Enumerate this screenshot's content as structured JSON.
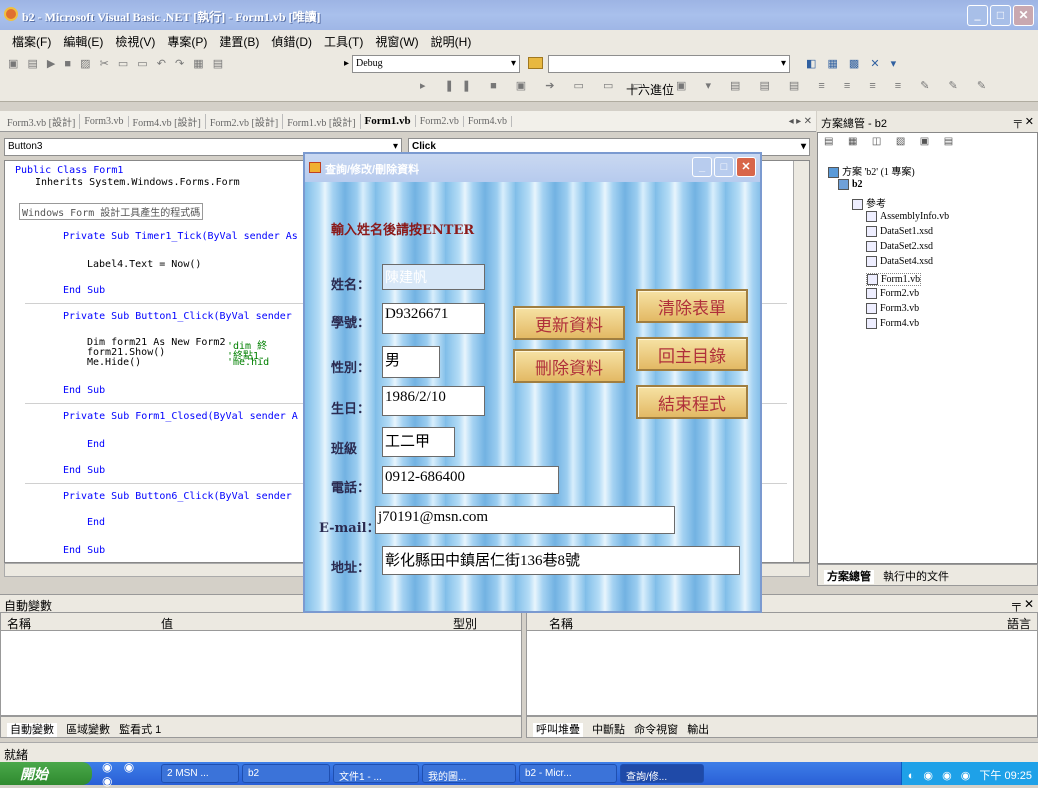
{
  "window": {
    "title": "b2 - Microsoft Visual Basic .NET [執行] - Form1.vb [唯讀]"
  },
  "menu": [
    "檔案(F)",
    "編輯(E)",
    "檢視(V)",
    "專案(P)",
    "建置(B)",
    "偵錯(D)",
    "工具(T)",
    "視窗(W)",
    "說明(H)"
  ],
  "toolbar": {
    "config": "Debug",
    "hex_label": "十六進位"
  },
  "tabs": [
    "Form3.vb [設計]",
    "Form3.vb",
    "Form4.vb [設計]",
    "Form2.vb [設計]",
    "Form1.vb [設計]",
    "Form1.vb",
    "Form2.vb",
    "Form4.vb"
  ],
  "code": {
    "object_combo": "Button3",
    "event_combo": "Click",
    "lines": [
      "Public Class Form1",
      "Inherits System.Windows.Forms.Form",
      "Windows Form 設計工具產生的程式碼",
      "Private Sub Timer1_Tick(ByVal sender As",
      "Label4.Text = Now()",
      "End Sub",
      "Private Sub Button1_Click(ByVal sender",
      "Dim form21 As New Form2",
      "form21.Show()",
      "Me.Hide()",
      "'dim 終",
      "'終點1.",
      "'me.hid",
      "End Sub",
      "Private Sub Form1_Closed(ByVal sender A",
      "End",
      "End Sub",
      "Private Sub Button6_Click(ByVal sender",
      "End",
      "End Sub"
    ]
  },
  "solution": {
    "header": "方案總管 - b2",
    "root": "方案 'b2' (1 專案)",
    "project": "b2",
    "items": [
      "參考",
      "AssemblyInfo.vb",
      "DataSet1.xsd",
      "DataSet2.xsd",
      "DataSet4.xsd",
      "Form1.vb",
      "Form2.vb",
      "Form3.vb",
      "Form4.vb"
    ],
    "bottom_tabs": [
      "方案總管",
      "執行中的文件"
    ]
  },
  "form": {
    "title": "查詢/修改/刪除資料",
    "prompt": "輸入姓名後請按ENTER",
    "labels": {
      "name": "姓名：",
      "id": "學號：",
      "gender": "性別：",
      "birth": "生日：",
      "class": "班級",
      "phone": "電話：",
      "email": "E-mail：",
      "address": "地址："
    },
    "values": {
      "name": "陳建帆",
      "id": "D9326671",
      "gender": "男",
      "birth": "1986/2/10",
      "class": "工二甲",
      "phone": "0912-686400",
      "email": "j70191@msn.com",
      "address": "彰化縣田中鎮居仁街136巷8號"
    },
    "buttons": {
      "update": "更新資料",
      "clear": "清除表單",
      "delete": "刪除資料",
      "main": "回主目錄",
      "exit": "結束程式"
    }
  },
  "autos": {
    "title": "自動變數",
    "cols": [
      "名稱",
      "值",
      "型別"
    ],
    "right_cols": [
      "名稱",
      "語言"
    ],
    "tabs": [
      "自動變數",
      "區域變數",
      "監看式 1"
    ],
    "right_tabs": [
      "呼叫堆疊",
      "中斷點",
      "命令視窗",
      "輸出"
    ]
  },
  "status": "就緒",
  "taskbar": {
    "start": "開始",
    "tasks": [
      "2 MSN ...",
      "b2",
      "文件1 - ...",
      "我的圖...",
      "b2 - Micr...",
      "查詢/修..."
    ],
    "time": "下午 09:25"
  }
}
